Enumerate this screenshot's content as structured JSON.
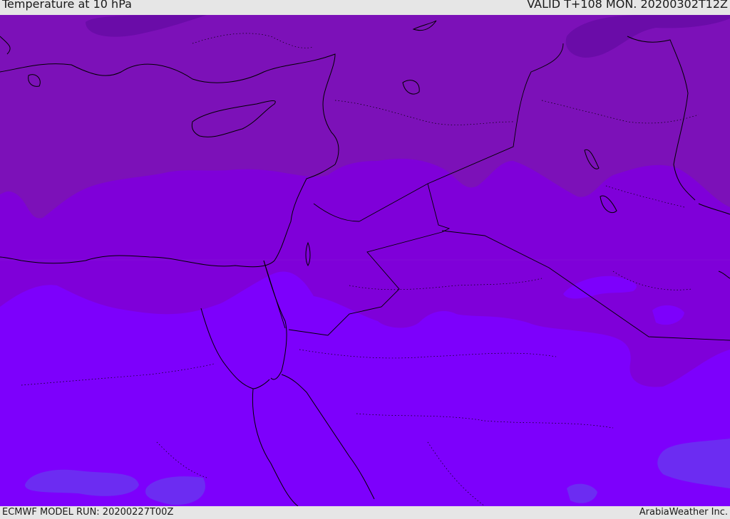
{
  "header": {
    "title": "Temperature at 10 hPa",
    "valid": "VALID T+108 MON. 20200302T12Z"
  },
  "footer": {
    "model_run": "ECMWF MODEL RUN: 20200227T00Z",
    "credit": "ArabiaWeather Inc."
  },
  "map": {
    "colors": {
      "band_dark": "#6a0ca8",
      "band_north": "#7c11b8",
      "band_mid": "#7f00d9",
      "band_south": "#7d00fc",
      "band_light": "#6c2cf2",
      "coastline": "#000000"
    }
  }
}
